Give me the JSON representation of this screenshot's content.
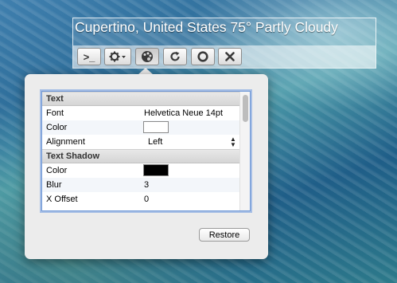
{
  "geeklet": {
    "output_text": "Cupertino, United States 75° Partly Cloudy"
  },
  "toolbar": {
    "buttons": [
      {
        "name": "terminal-button",
        "icon": "terminal-icon",
        "label": ">_"
      },
      {
        "name": "settings-button",
        "icon": "gear-icon"
      },
      {
        "name": "appearance-button",
        "icon": "palette-icon",
        "active": true
      },
      {
        "name": "refresh-button",
        "icon": "refresh-icon"
      },
      {
        "name": "stop-button",
        "icon": "stop-icon"
      },
      {
        "name": "close-button",
        "icon": "close-icon"
      }
    ]
  },
  "inspector": {
    "sections": [
      {
        "title": "Text",
        "rows": [
          {
            "name": "Font",
            "value": "Helvetica Neue 14pt"
          },
          {
            "name": "Color",
            "swatch": "#ffffff"
          },
          {
            "name": "Alignment",
            "value": "Left"
          }
        ]
      },
      {
        "title": "Text Shadow",
        "rows": [
          {
            "name": "Color",
            "swatch": "#000000"
          },
          {
            "name": "Blur",
            "value": "3"
          },
          {
            "name": "X Offset",
            "value": "0"
          }
        ]
      }
    ]
  },
  "restore_label": "Restore"
}
